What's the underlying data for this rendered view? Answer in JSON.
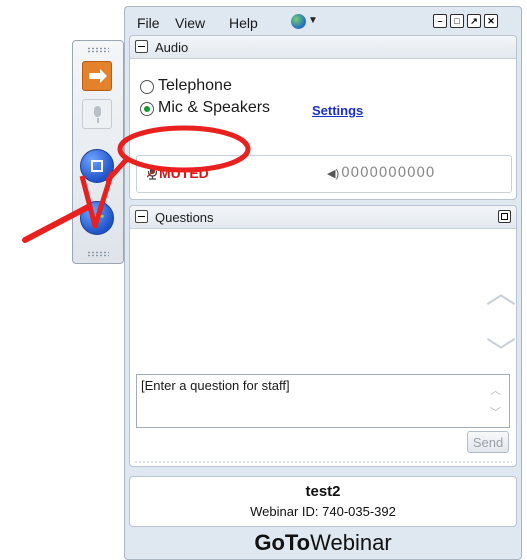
{
  "menu": {
    "file": "File",
    "view": "View",
    "help": "Help"
  },
  "audio": {
    "title": "Audio",
    "telephone_label": "Telephone",
    "mic_label": "Mic & Speakers",
    "settings_link": "Settings",
    "selected_option": "Mic & Speakers",
    "status_text": "MUTED",
    "level_meter": "0000000000"
  },
  "questions": {
    "title": "Questions",
    "input_placeholder": "[Enter a question for staff]",
    "send_label": "Send"
  },
  "session": {
    "name": "test2",
    "webinar_id_label": "Webinar ID: 740-035-392"
  },
  "brand": {
    "bold": "GoTo",
    "rest": "Webinar"
  },
  "colors": {
    "muted_red": "#d11b1b",
    "accent_orange": "#e4822c",
    "annotation_red": "#e8201e",
    "link_blue": "#1c2fc9"
  },
  "icons": [
    "globe-icon",
    "minimize-icon",
    "restore-icon",
    "popout-icon",
    "close-icon",
    "arrow-icon",
    "microphone-icon",
    "screen-icon",
    "raise-hand-icon",
    "speaker-icon"
  ]
}
